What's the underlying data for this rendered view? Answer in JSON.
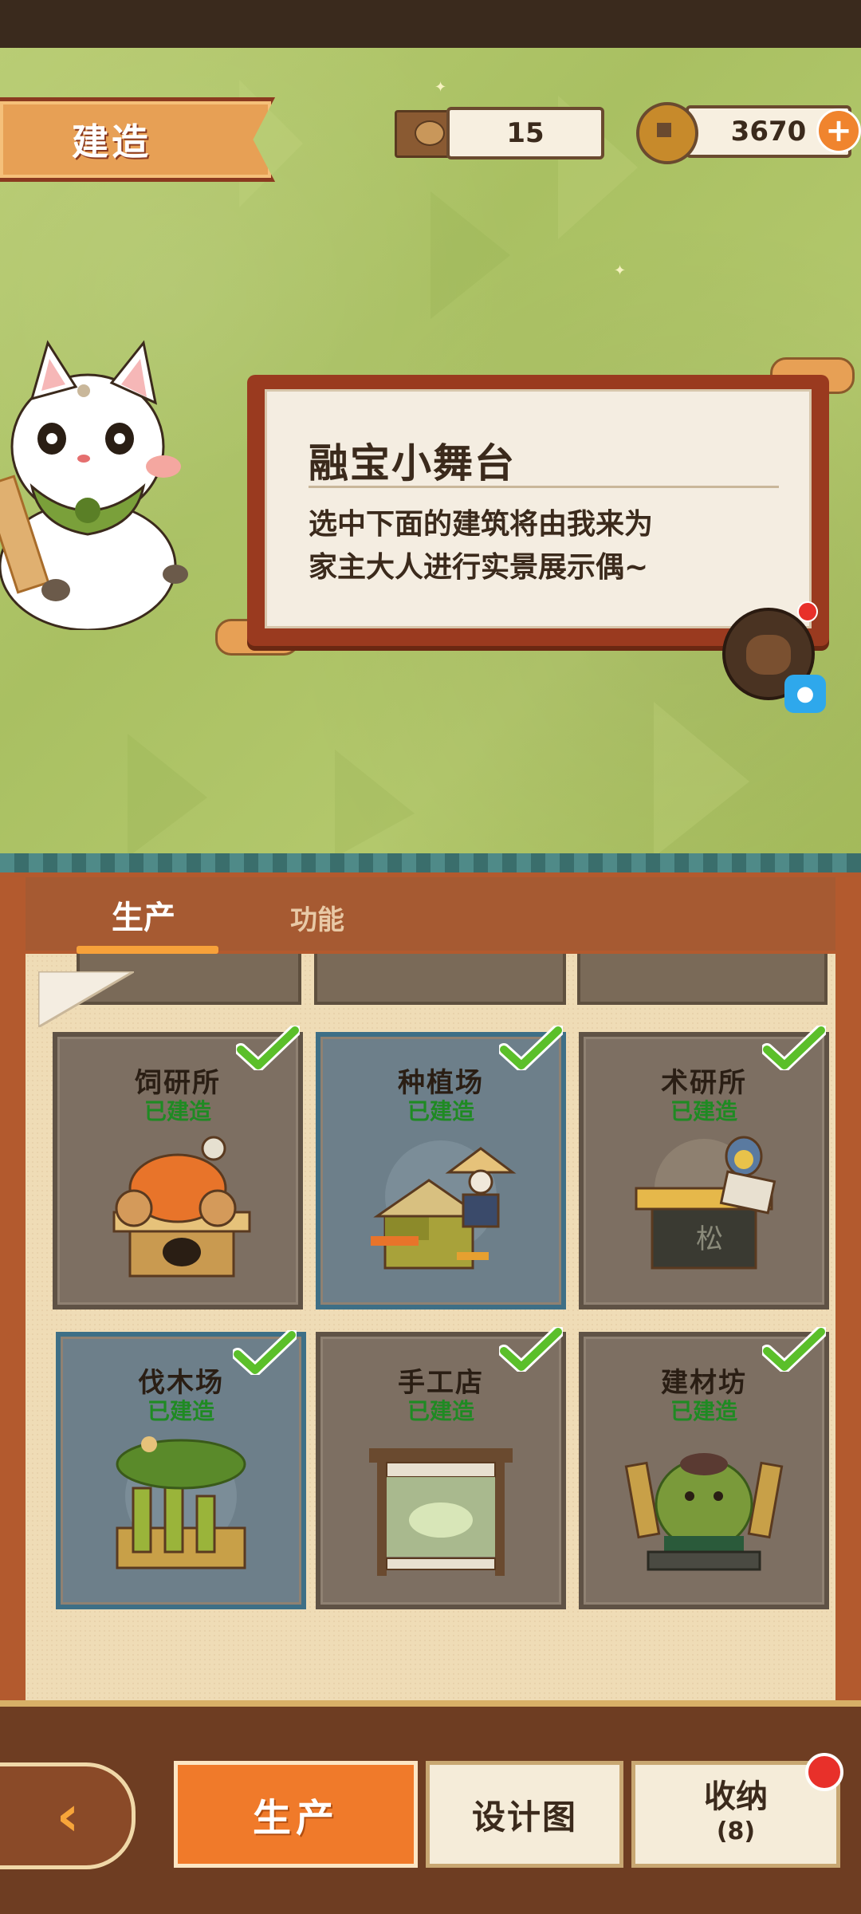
{
  "header": {
    "title": "建造",
    "resource_wood": "15",
    "resource_coins": "3670",
    "add_label": "+"
  },
  "dialog": {
    "title": "融宝小舞台",
    "body_line1": "选中下面的建筑将由我来为",
    "body_line2": "家主大人进行实景展示偶~"
  },
  "tabs": [
    {
      "label": "生产",
      "active": true
    },
    {
      "label": "功能",
      "active": false
    }
  ],
  "buildings": [
    {
      "name": "饲研所",
      "status": "已建造",
      "highlighted": false,
      "built": true
    },
    {
      "name": "种植场",
      "status": "已建造",
      "highlighted": true,
      "built": true
    },
    {
      "name": "术研所",
      "status": "已建造",
      "highlighted": false,
      "built": true
    },
    {
      "name": "伐木场",
      "status": "已建造",
      "highlighted": true,
      "built": true
    },
    {
      "name": "手工店",
      "status": "已建造",
      "highlighted": false,
      "built": true
    },
    {
      "name": "建材坊",
      "status": "已建造",
      "highlighted": false,
      "built": true
    }
  ],
  "bottom_bar": {
    "back_icon": "‹",
    "production_label": "生产",
    "design_label": "设计图",
    "storage_label": "收纳",
    "storage_count": "(8)"
  },
  "colors": {
    "accent_orange": "#f07a2a",
    "built_green": "#1f8a23",
    "check_green": "#5bbf2a"
  }
}
